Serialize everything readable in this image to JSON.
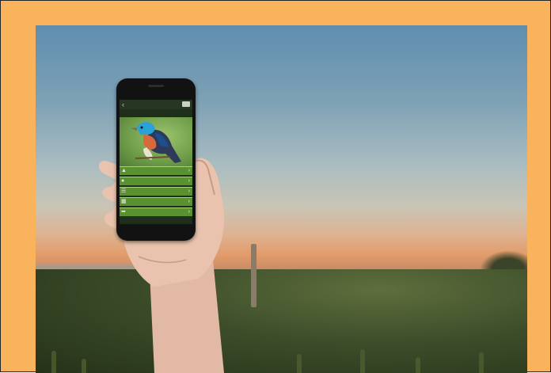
{
  "app": {
    "title": "",
    "subtitle": "",
    "back_icon": "back-arrow-icon",
    "menu_icon": "menu-icon"
  },
  "menu": {
    "items": [
      {
        "label": "",
        "icon": "bird-icon"
      },
      {
        "label": "",
        "icon": "info-icon"
      },
      {
        "label": "",
        "icon": "list-icon"
      },
      {
        "label": "",
        "icon": "map-icon"
      },
      {
        "label": "",
        "icon": "feather-icon"
      }
    ]
  },
  "colors": {
    "frame_border": "#F8B35C",
    "sky_top": "#5F8EAF",
    "sunset": "#E39C6A",
    "field": "#3D4D2A",
    "app_green": "#5A9130"
  }
}
